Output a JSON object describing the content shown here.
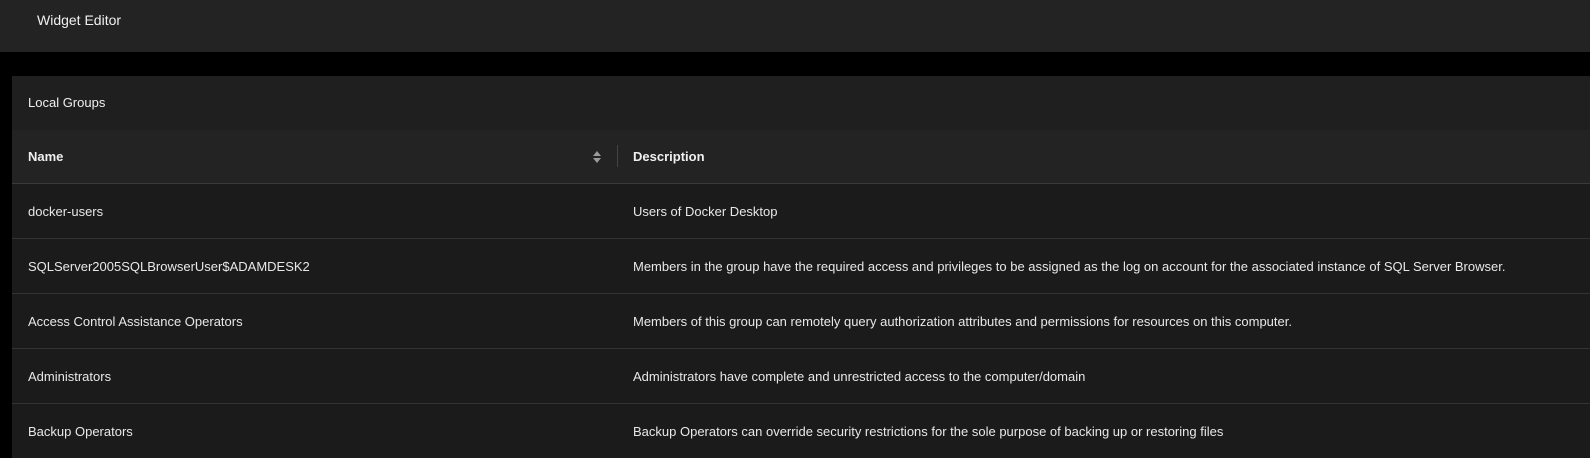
{
  "window": {
    "title": "Widget Editor"
  },
  "panel": {
    "title": "Local Groups",
    "columns": {
      "name": "Name",
      "description": "Description"
    },
    "rows": [
      {
        "name": "docker-users",
        "description": "Users of Docker Desktop"
      },
      {
        "name": "SQLServer2005SQLBrowserUser$ADAMDESK2",
        "description": "Members in the group have the required access and privileges to be assigned as the log on account for the associated instance of SQL Server Browser."
      },
      {
        "name": "Access Control Assistance Operators",
        "description": "Members of this group can remotely query authorization attributes and permissions for resources on this computer."
      },
      {
        "name": "Administrators",
        "description": "Administrators have complete and unrestricted access to the computer/domain"
      },
      {
        "name": "Backup Operators",
        "description": "Backup Operators can override security restrictions for the sole purpose of backing up or restoring files"
      }
    ]
  },
  "icons": {
    "sort": "sort-icon"
  },
  "colors": {
    "background": "#000000",
    "topbar": "#232323",
    "panel": "#1b1b1b",
    "header_row": "#232323",
    "text": "#e8e8e8"
  }
}
